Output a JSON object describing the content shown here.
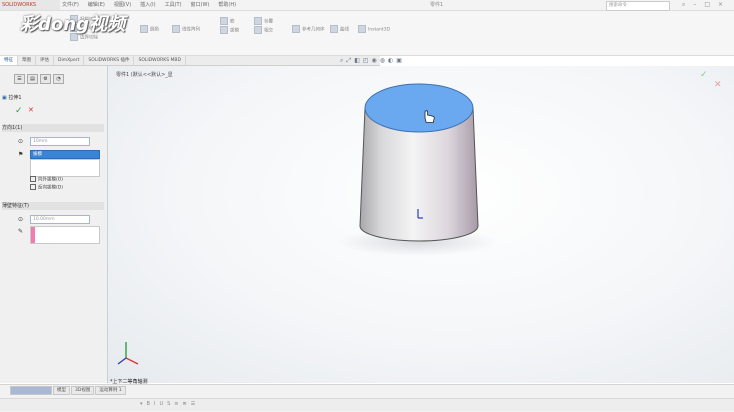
{
  "menubar": {
    "app_logo": "SOLIDWORKS",
    "menus": [
      "文件(F)",
      "编辑(E)",
      "视图(V)",
      "插入(I)",
      "工具(T)",
      "窗口(W)",
      "帮助(H)"
    ],
    "doc_title": "零件1",
    "search_placeholder": "搜索命令"
  },
  "watermark": "彩dong视频",
  "ribbon": {
    "groups": [
      "扫描切除",
      "放样切割",
      "边界切除",
      "圆角",
      "线性阵列",
      "筋",
      "拔模",
      "包覆",
      "相交",
      "参考几何体",
      "曲线",
      "Instant3D"
    ]
  },
  "tabs": [
    "特征",
    "草图",
    "评估",
    "DimXpert",
    "SOLIDWORKS 插件",
    "SOLIDWORKS MBD"
  ],
  "active_tab": 0,
  "panel": {
    "icons": [
      "特征树",
      "属性",
      "配置",
      "外观"
    ],
    "title": "拉伸1",
    "ok_symbol": "✓",
    "cancel_symbol": "✕",
    "direction_label": "方向1(1)",
    "depth_value": "10mm",
    "depth_placeholder": "拔模",
    "checkbox_1": "向外拔模(O)",
    "checkbox_2": "反向拔模(D)",
    "thin_label": "薄壁特征(T)",
    "thin_value": "10.00mm"
  },
  "viewport": {
    "breadcrumb": "零件1 (默认<<默认>_显",
    "view_label": "*上下二等角轴测",
    "accept": "✓",
    "reject": "✕"
  },
  "bottom": {
    "tabs": [
      "模型",
      "3D视图",
      "运动算例 1"
    ]
  },
  "colors": {
    "cap_top": "#6aa9ef",
    "accent": "#1a5aa0"
  }
}
